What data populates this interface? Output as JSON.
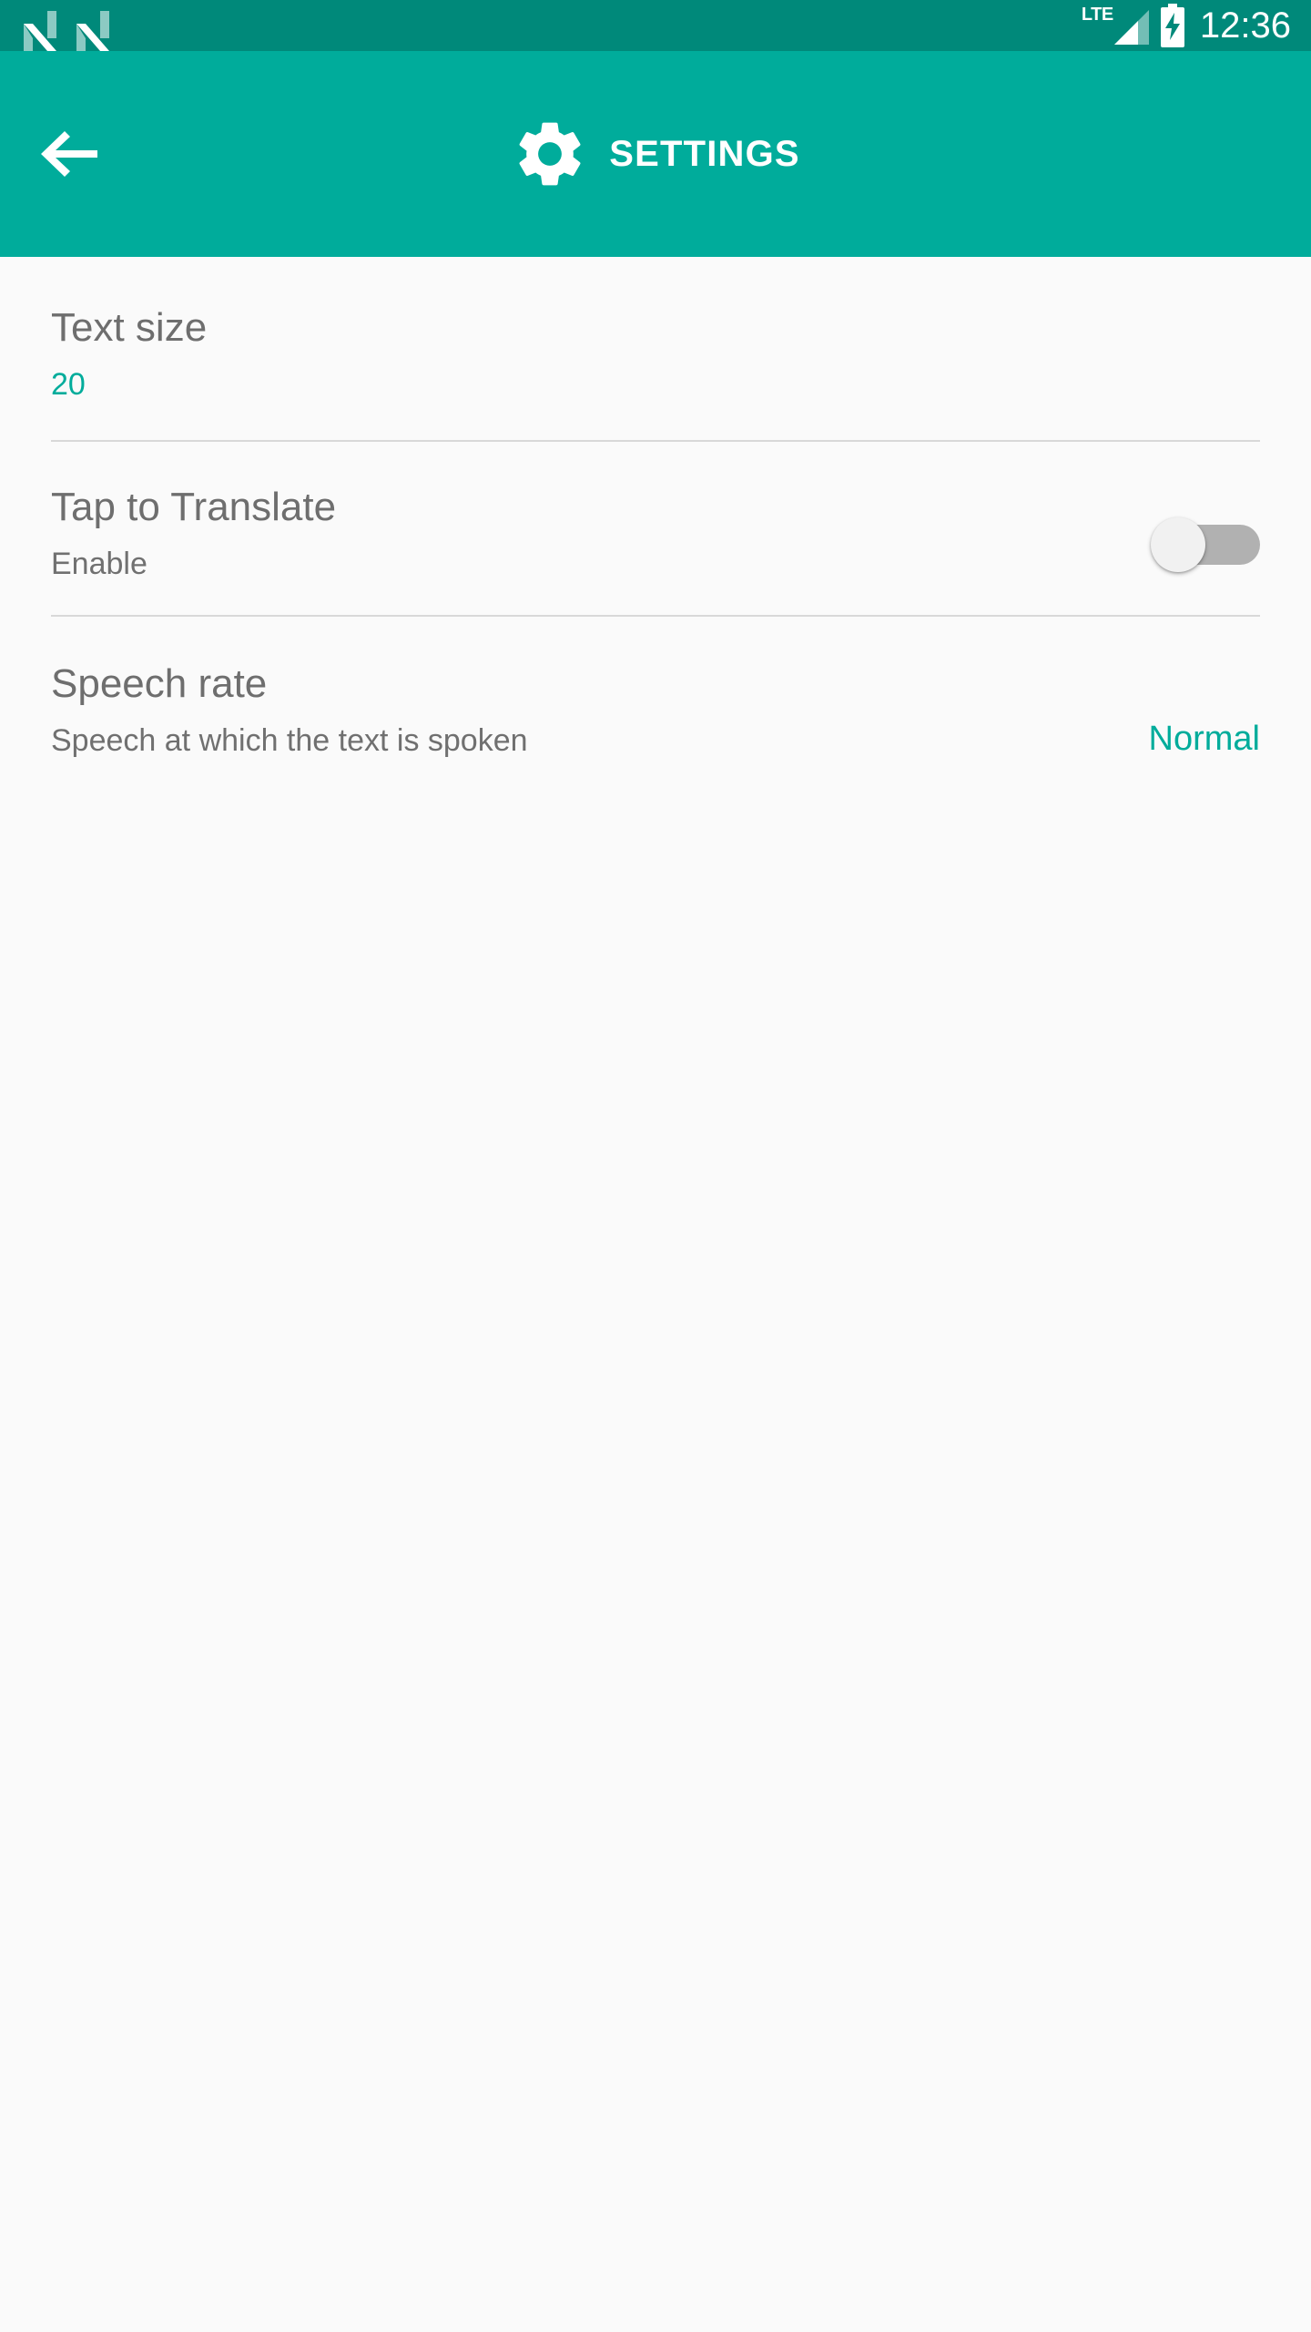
{
  "status_bar": {
    "notification_icons": [
      "android-n-icon",
      "android-n-icon"
    ],
    "network_label": "LTE",
    "signal_icon": "signal-bars-icon",
    "battery_icon": "battery-charging-icon",
    "time": "12:36"
  },
  "toolbar": {
    "back_icon": "arrow-back-icon",
    "gear_icon": "gear-icon",
    "title": "SETTINGS"
  },
  "settings": {
    "rows": [
      {
        "name": "text-size",
        "title": "Text size",
        "summary": "20",
        "summary_accent": true,
        "control": "none"
      },
      {
        "name": "tap-to-translate",
        "title": "Tap to Translate",
        "summary": "Enable",
        "summary_accent": false,
        "control": "switch",
        "switch_state": "off"
      },
      {
        "name": "speech-rate",
        "title": "Speech rate",
        "summary": "Speech at which the text is spoken",
        "summary_accent": false,
        "control": "value",
        "value": "Normal"
      }
    ]
  },
  "colors": {
    "status_bar_bg": "#00897a",
    "toolbar_bg": "#00ac9b",
    "accent": "#00ac9b",
    "page_bg": "#fafafa",
    "title_text": "#6e6e6e",
    "summary_text": "#707070",
    "divider": "#d8d8d8",
    "switch_track_off": "#b1b1b1",
    "switch_thumb_off": "#f1f1f1"
  }
}
